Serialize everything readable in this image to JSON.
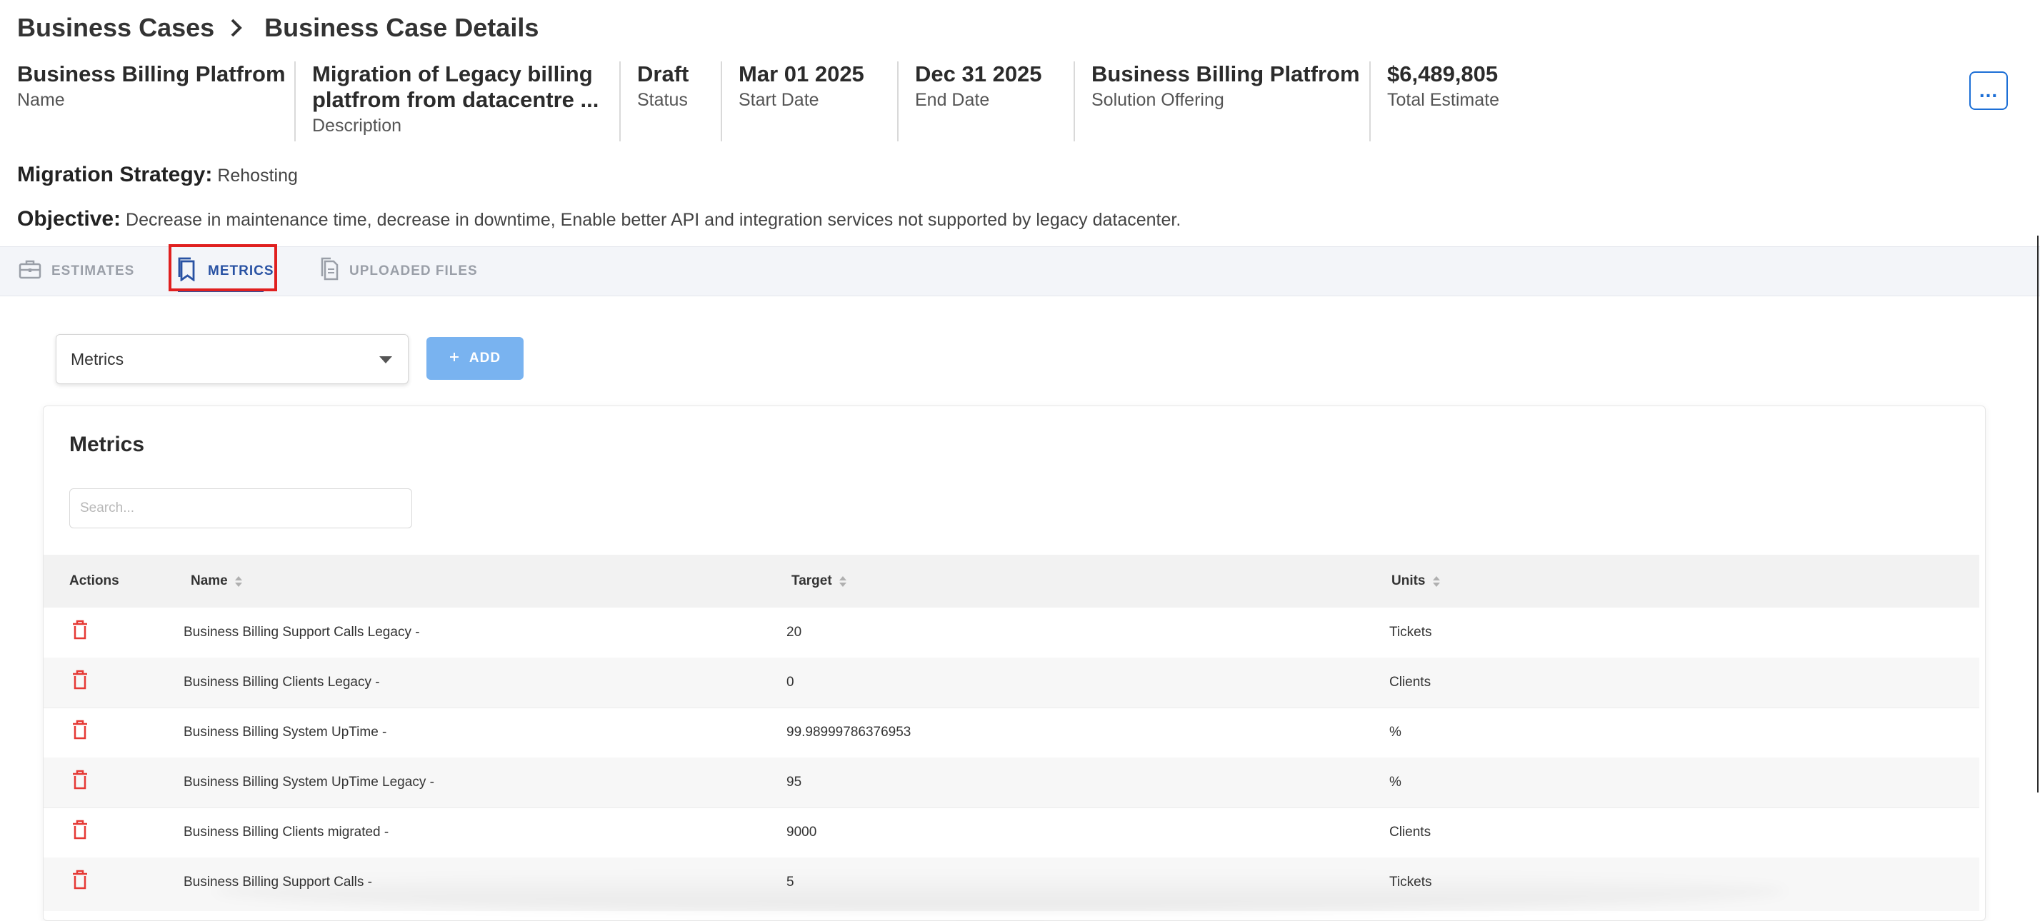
{
  "breadcrumb": {
    "parent": "Business Cases",
    "current": "Business Case Details"
  },
  "summary": {
    "name_value": "Business Billing Platfrom",
    "name_label": "Name",
    "description_value": "Migration of Legacy billing platfrom from datacentre ...",
    "description_label": "Description",
    "status_value": "Draft",
    "status_label": "Status",
    "start_value": "Mar 01 2025",
    "start_label": "Start Date",
    "end_value": "Dec 31 2025",
    "end_label": "End Date",
    "offering_value": "Business Billing Platfrom",
    "offering_label": "Solution Offering",
    "total_value": "$6,489,805",
    "total_label": "Total Estimate"
  },
  "more_button": "...",
  "strategy": {
    "label": "Migration Strategy:",
    "value": "Rehosting"
  },
  "objective": {
    "label": "Objective:",
    "value": "Decrease in maintenance time, decrease in downtime, Enable better API and integration services not supported by legacy datacenter."
  },
  "tabs": [
    {
      "label": "ESTIMATES",
      "icon": "briefcase-icon",
      "active": false
    },
    {
      "label": "METRICS",
      "icon": "bookmarks-icon",
      "active": true
    },
    {
      "label": "UPLOADED FILES",
      "icon": "file-copy-icon",
      "active": false
    }
  ],
  "controls": {
    "select_value": "Metrics",
    "add_label": "ADD",
    "add_icon": "plus-icon"
  },
  "table": {
    "title": "Metrics",
    "search_placeholder": "Search...",
    "columns": {
      "actions": "Actions",
      "name": "Name",
      "target": "Target",
      "units": "Units"
    },
    "rows": [
      {
        "name": "Business Billing Support Calls Legacy -",
        "target": "20",
        "units": "Tickets"
      },
      {
        "name": "Business Billing Clients Legacy -",
        "target": "0",
        "units": "Clients"
      },
      {
        "name": "Business Billing System UpTime -",
        "target": "99.98999786376953",
        "units": "%"
      },
      {
        "name": "Business Billing System UpTime Legacy -",
        "target": "95",
        "units": "%"
      },
      {
        "name": "Business Billing Clients migrated -",
        "target": "9000",
        "units": "Clients"
      },
      {
        "name": "Business Billing Support Calls -",
        "target": "5",
        "units": "Tickets"
      }
    ]
  },
  "colors": {
    "accent": "#2952a3",
    "button": "#79b3f0",
    "delete": "#e53935",
    "highlight": "#e02020"
  }
}
